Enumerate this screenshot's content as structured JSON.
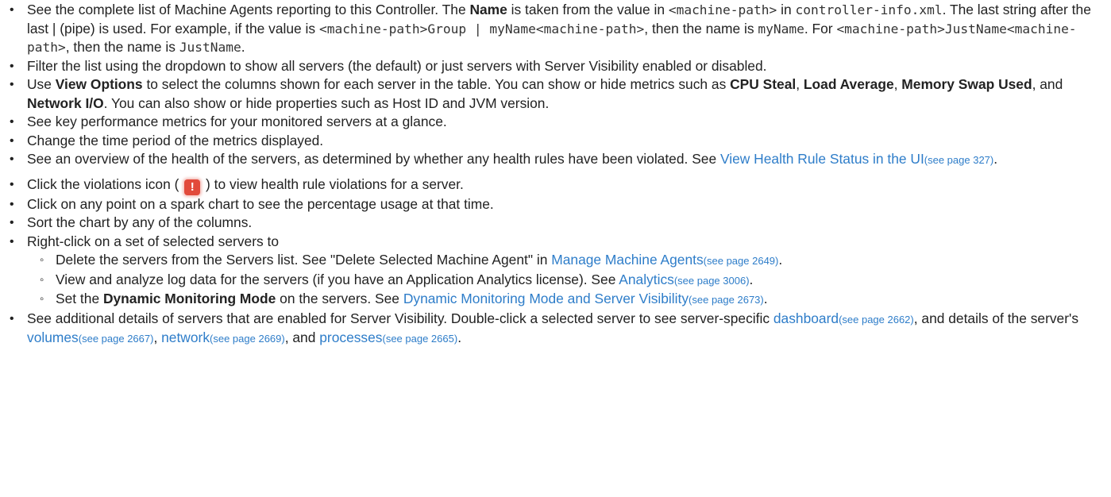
{
  "colors": {
    "link": "#2e7dc9",
    "text": "#222222",
    "violation_icon_bg": "#e24a3b"
  },
  "icons": {
    "violation": "exclamation-icon"
  },
  "b1": {
    "t1": "See the complete list of Machine Agents reporting to this Controller. The ",
    "name_bold": "Name",
    "t2": " is taken from the value in ",
    "c1": "<machine-path>",
    "t3": " in ",
    "c2": "controller-info.xml",
    "t4": ". The last string after the last | (pipe) is used. For example, if the value is ",
    "c3": "<machine-path>Group  | myName<machine-path>",
    "t5": ", then the name is ",
    "c4": "myName",
    "t6": ". For ",
    "c5": "<machine-path>JustName<machine-path>",
    "t7": ", then the name is ",
    "c6": "JustName",
    "t8": "."
  },
  "b2": {
    "text": "Filter the list using the dropdown to show all servers (the default) or just servers with Server Visibility enabled or disabled."
  },
  "b3": {
    "t1": "Use ",
    "view_options": "View Options",
    "t2": " to select the columns shown for each server in the table. You can show or hide metrics such as ",
    "cpu_steal": "CPU Steal",
    "t3": ", ",
    "load_average": "Load Average",
    "t4": ", ",
    "memory_swap": "Memory Swap Used",
    "t5": ", and ",
    "network_io": "Network I/O",
    "t6": ". You can also show or hide properties such as Host ID and JVM version."
  },
  "b4": {
    "text": "See key performance metrics for your monitored servers at a glance."
  },
  "b5": {
    "text": "Change the time period of the metrics displayed."
  },
  "b6": {
    "t1": "See an overview of the health of the servers, as determined by whether any health rules have been violated.  See ",
    "link": "View Health Rule Status in the UI",
    "ref": "(see page 327)",
    "t2": "."
  },
  "b7": {
    "t1": "Click the violations icon ( ",
    "icon_glyph": "!",
    "t2": " ) to view health rule violations for a server."
  },
  "b8": {
    "text": "Click on any point on a spark chart to see the percentage usage at that time."
  },
  "b9": {
    "text": "Sort the chart by any of the columns."
  },
  "b10": {
    "text": "Right-click on a set of selected servers to",
    "s1": {
      "t1": "Delete the servers from the Servers list. See \"Delete Selected Machine Agent\" in ",
      "link": "Manage Machine Agents",
      "ref": "(see page 2649)",
      "t2": "."
    },
    "s2": {
      "t1": "View and analyze log data for the servers (if you have an Application Analytics license). See ",
      "link": "Analytics",
      "ref": "(see page 3006)",
      "t2": "."
    },
    "s3": {
      "t1": "Set the ",
      "bold": "Dynamic Monitoring Mode",
      "t2": " on the servers. See ",
      "link": "Dynamic Monitoring Mode and Server Visibility",
      "ref": "(see page 2673)",
      "t3": "."
    }
  },
  "b11": {
    "t1": "See additional details of servers that are enabled for Server Visibility. Double-click a selected server to see server-specific ",
    "link1": "dashboard",
    "ref1": "(see page 2662)",
    "t2": ", and details of the server's ",
    "link2": "volumes",
    "ref2": "(see page 2667)",
    "t3": ", ",
    "link3": "network",
    "ref3": "(see page 2669)",
    "t4": ", and ",
    "link4": "processes",
    "ref4": "(see page 2665)",
    "t5": "."
  }
}
